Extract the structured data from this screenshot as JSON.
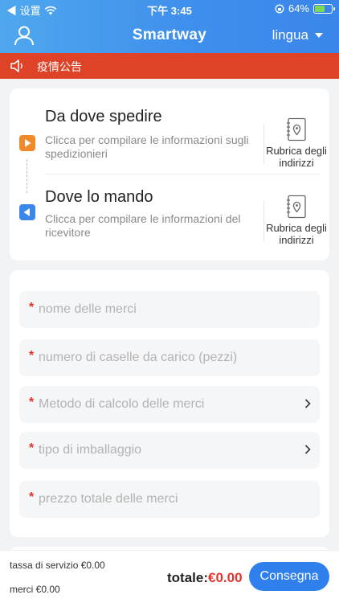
{
  "status_bar": {
    "back_label": "◀ 设置",
    "time": "下午 3:45",
    "battery": "64%",
    "battery_level": 0.64
  },
  "nav": {
    "title": "Smartway",
    "language_label": "lingua"
  },
  "notice": {
    "text": "疫情公告"
  },
  "sender": {
    "title": "Da dove spedire",
    "description": "Clicca per compilare le informazioni sugli spedizionieri",
    "address_book_label": "Rubrica degli indirizzi"
  },
  "receiver": {
    "title": "Dove lo mando",
    "description": "Clicca per compilare le informazioni del ricevitore",
    "address_book_label": "Rubrica degli indirizzi"
  },
  "form": {
    "required_mark": "*",
    "goods_name_placeholder": "nome delle merci",
    "box_count_placeholder": "numero di caselle da carico (pezzi)",
    "calc_method_placeholder": "Metodo di calcolo delle merci",
    "packaging_placeholder": "tipo di imballaggio",
    "total_price_placeholder": "prezzo totale delle merci"
  },
  "footer": {
    "service_fee": "tassa di servizio €0.00",
    "goods_fee": "merci €0.00",
    "total_label": "totale:",
    "total_value": "€0.00",
    "submit_label": "Consegna"
  },
  "colors": {
    "header_blue": "#3f8fec",
    "notice_red": "#de4327",
    "sender_orange": "#f08a2a",
    "receiver_blue": "#3a86ea",
    "price_red": "#e3322b",
    "button_blue": "#2f80ed"
  }
}
